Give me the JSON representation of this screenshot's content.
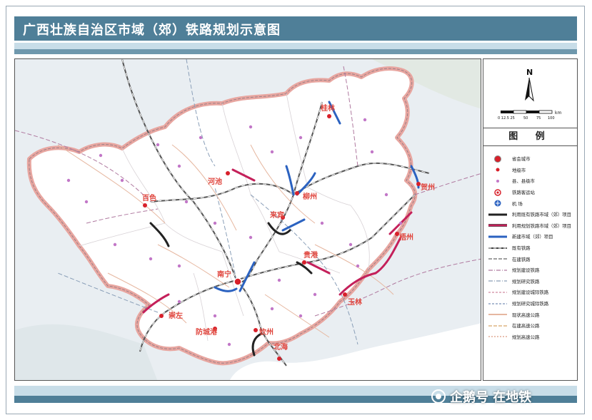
{
  "title": "广西壮族自治区市域（郊）铁路规划示意图",
  "north_label": "N",
  "scale": {
    "ticks": [
      "0 12.5 25",
      "50",
      "75",
      "100"
    ],
    "unit": "km"
  },
  "legend": {
    "title": "图 例",
    "items": [
      {
        "id": "capital",
        "label": "省会城市",
        "symbol": "capital-icon"
      },
      {
        "id": "prefecture",
        "label": "地级市",
        "symbol": "prefecture-dot-icon"
      },
      {
        "id": "county",
        "label": "县、县级市",
        "symbol": "county-dot-icon"
      },
      {
        "id": "station",
        "label": "铁路客运站",
        "symbol": "station-icon"
      },
      {
        "id": "airport",
        "label": "机  场",
        "symbol": "airport-icon"
      },
      {
        "id": "existing-urban",
        "label": "利用既有铁路市域（郊）项目",
        "symbol": "black-line"
      },
      {
        "id": "planned-urban",
        "label": "利用规划铁路市域（郊）项目",
        "symbol": "pink-line"
      },
      {
        "id": "new-urban",
        "label": "新建市域（郊）项目",
        "symbol": "blue-line"
      },
      {
        "id": "existing-rail",
        "label": "既有铁路",
        "symbol": "existing-rail"
      },
      {
        "id": "building-rail",
        "label": "在建铁路",
        "symbol": "building-rail"
      },
      {
        "id": "planned-rail",
        "label": "规划建设铁路",
        "symbol": "planned-rail"
      },
      {
        "id": "research-rail",
        "label": "规划研究铁路",
        "symbol": "research-rail"
      },
      {
        "id": "planned-intercity",
        "label": "规划建设城际铁路",
        "symbol": "planned-intercity"
      },
      {
        "id": "research-intercity",
        "label": "规划研究城际铁路",
        "symbol": "research-intercity"
      },
      {
        "id": "existing-highway",
        "label": "现状高速公路",
        "symbol": "existing-highway"
      },
      {
        "id": "building-highway",
        "label": "在建高速公路",
        "symbol": "building-highway"
      },
      {
        "id": "planned-highway",
        "label": "规划高速公路",
        "symbol": "planned-highway"
      }
    ]
  },
  "cities": [
    {
      "name": "桂林",
      "kind": "prefecture"
    },
    {
      "name": "河池",
      "kind": "prefecture"
    },
    {
      "name": "柳州",
      "kind": "prefecture"
    },
    {
      "name": "贺州",
      "kind": "prefecture"
    },
    {
      "name": "百色",
      "kind": "prefecture"
    },
    {
      "name": "来宾",
      "kind": "prefecture"
    },
    {
      "name": "梧州",
      "kind": "prefecture"
    },
    {
      "name": "贵港",
      "kind": "prefecture"
    },
    {
      "name": "南宁",
      "kind": "capital"
    },
    {
      "name": "崇左",
      "kind": "prefecture"
    },
    {
      "name": "玉林",
      "kind": "prefecture"
    },
    {
      "name": "防城港",
      "kind": "prefecture"
    },
    {
      "name": "钦州",
      "kind": "prefecture"
    },
    {
      "name": "北海",
      "kind": "prefecture"
    }
  ],
  "colors": {
    "title_bar": "#4f7f98",
    "province_fill": "#ffffff",
    "province_border": "#e8a6a0",
    "city_label": "#e0463e",
    "urban_existing": "#222222",
    "urban_planned": "#c4205a",
    "urban_new": "#2b62c0"
  },
  "watermark": "企鹅号 在地铁"
}
